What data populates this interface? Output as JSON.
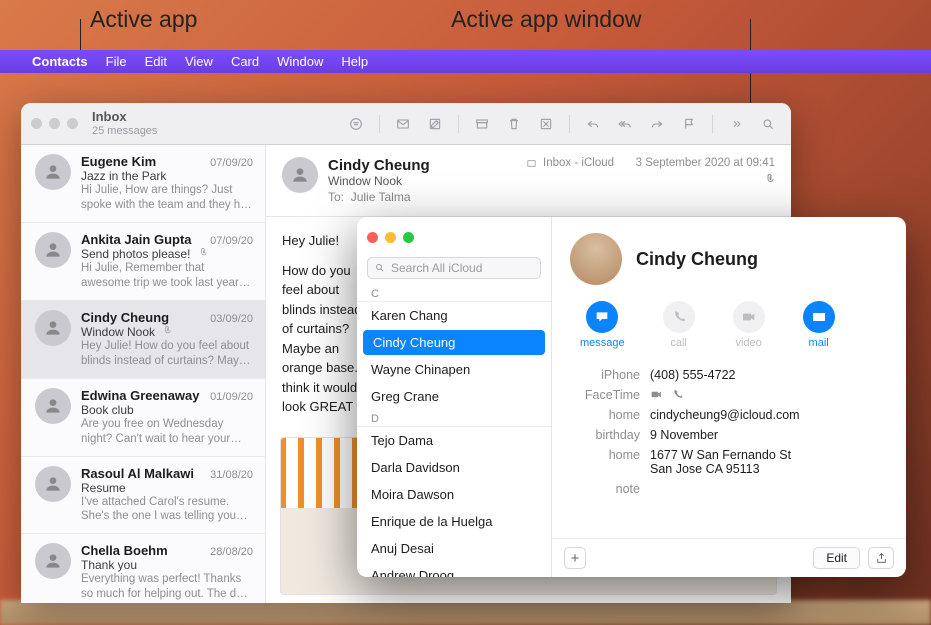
{
  "callouts": {
    "active_app": "Active app",
    "active_app_window": "Active app window"
  },
  "menubar": {
    "app_name": "Contacts",
    "items": {
      "file": "File",
      "edit": "Edit",
      "view": "View",
      "card": "Card",
      "window": "Window",
      "help": "Help"
    }
  },
  "mail": {
    "title": "Inbox",
    "subtitle": "25 messages",
    "toolbar": {},
    "messages": [
      {
        "name": "Eugene Kim",
        "date": "07/09/20",
        "subject": "Jazz in the Park",
        "preview": "Hi Julie, How are things? Just spoke with the team and they had a few co…",
        "attach": false
      },
      {
        "name": "Ankita Jain Gupta",
        "date": "07/09/20",
        "subject": "Send photos please!",
        "preview": "Hi Julie, Remember that awesome trip we took last year? I found this pictur…",
        "attach": true
      },
      {
        "name": "Cindy Cheung",
        "date": "03/09/20",
        "subject": "Window Nook",
        "preview": "Hey Julie! How do you feel about blinds instead of curtains? Maybe a…",
        "attach": true,
        "selected": true
      },
      {
        "name": "Edwina Greenaway",
        "date": "01/09/20",
        "subject": "Book club",
        "preview": "Are you free on Wednesday night? Can't wait to hear your thoughts on t…",
        "attach": false
      },
      {
        "name": "Rasoul Al Malkawi",
        "date": "31/08/20",
        "subject": "Resume",
        "preview": "I've attached Carol's resume. She's the one I was telling you about. She…",
        "attach": false
      },
      {
        "name": "Chella Boehm",
        "date": "28/08/20",
        "subject": "Thank you",
        "preview": "Everything was perfect! Thanks so much for helping out. The day was a…",
        "attach": false
      }
    ],
    "header": {
      "from": "Cindy Cheung",
      "subject": "Window Nook",
      "to_label": "To:",
      "to": "Julie Talma",
      "mailbox_label": "Inbox - iCloud",
      "date": "3 September 2020 at 09:41"
    },
    "body_lines": {
      "l1": "Hey Julie!",
      "l2": "How do you feel about blinds instead of curtains? Maybe an orange base. I think it would look GREAT"
    }
  },
  "contacts": {
    "search_placeholder": "Search All iCloud",
    "sections": [
      {
        "letter": "C",
        "items": [
          "Karen Chang",
          "Cindy Cheung",
          "Wayne Chinapen",
          "Greg Crane"
        ]
      },
      {
        "letter": "D",
        "items": [
          "Tejo Dama",
          "Darla Davidson",
          "Moira Dawson",
          "Enrique de la Huelga",
          "Anuj Desai",
          "Andrew Droog"
        ]
      }
    ],
    "selected": "Cindy Cheung",
    "card": {
      "name": "Cindy Cheung",
      "actions": {
        "message": "message",
        "call": "call",
        "video": "video",
        "mail": "mail"
      },
      "fields": {
        "iphone_label": "iPhone",
        "iphone": "(408) 555-4722",
        "facetime_label": "FaceTime",
        "home_email_label": "home",
        "home_email": "cindycheung9@icloud.com",
        "birthday_label": "birthday",
        "birthday": "9 November",
        "home_addr_label": "home",
        "home_addr_l1": "1677 W San Fernando St",
        "home_addr_l2": "San Jose CA 95113",
        "note_label": "note"
      },
      "edit_label": "Edit"
    }
  }
}
